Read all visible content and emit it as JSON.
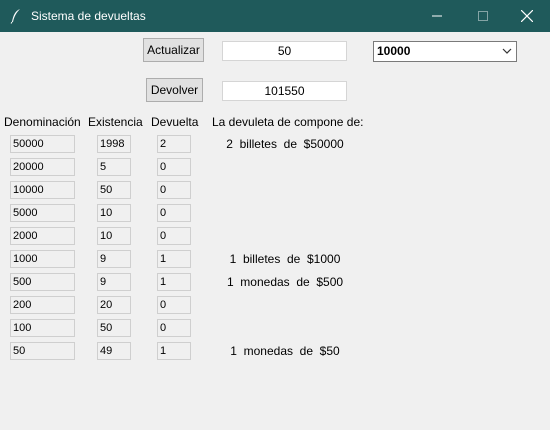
{
  "window": {
    "title": "Sistema de devueltas"
  },
  "controls": {
    "update_label": "Actualizar",
    "return_label": "Devolver",
    "amount_value": "50",
    "selected_denomination": "10000",
    "paid_value": "101550"
  },
  "table": {
    "headers": [
      "Denominación",
      "Existencia",
      "Devuelta",
      "La devuleta de compone de:"
    ],
    "rows": [
      {
        "denomination": "50000",
        "stock": "1998",
        "change": "2",
        "summary": "2  billetes  de  $50000"
      },
      {
        "denomination": "20000",
        "stock": "5",
        "change": "0",
        "summary": ""
      },
      {
        "denomination": "10000",
        "stock": "50",
        "change": "0",
        "summary": ""
      },
      {
        "denomination": "5000",
        "stock": "10",
        "change": "0",
        "summary": ""
      },
      {
        "denomination": "2000",
        "stock": "10",
        "change": "0",
        "summary": ""
      },
      {
        "denomination": "1000",
        "stock": "9",
        "change": "1",
        "summary": "1  billetes  de  $1000"
      },
      {
        "denomination": "500",
        "stock": "9",
        "change": "1",
        "summary": "1  monedas  de  $500"
      },
      {
        "denomination": "200",
        "stock": "20",
        "change": "0",
        "summary": ""
      },
      {
        "denomination": "100",
        "stock": "50",
        "change": "0",
        "summary": ""
      },
      {
        "denomination": "50",
        "stock": "49",
        "change": "1",
        "summary": "1  monedas  de  $50"
      }
    ]
  }
}
